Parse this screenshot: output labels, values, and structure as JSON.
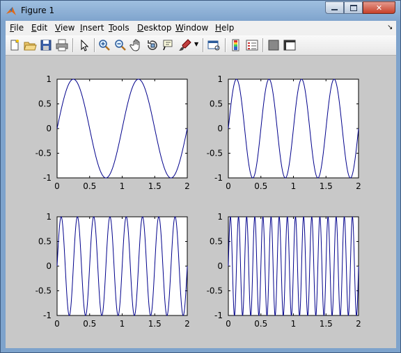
{
  "window": {
    "title": "Figure 1"
  },
  "menu": [
    {
      "key": "F",
      "rest": "ile"
    },
    {
      "key": "E",
      "rest": "dit"
    },
    {
      "key": "V",
      "rest": "iew"
    },
    {
      "key": "I",
      "rest": "nsert"
    },
    {
      "key": "T",
      "rest": "ools"
    },
    {
      "key": "D",
      "rest": "esktop"
    },
    {
      "key": "W",
      "rest": "indow"
    },
    {
      "key": "H",
      "rest": "elp"
    }
  ],
  "toolbar": [
    "new-figure-icon",
    "open-file-icon",
    "save-icon",
    "print-icon",
    "select-arrow-icon",
    "zoom-in-icon",
    "zoom-out-icon",
    "pan-hand-icon",
    "rotate-3d-icon",
    "data-cursor-icon",
    "brush-icon",
    "link-plot-icon",
    "colorbar-icon",
    "legend-icon",
    "hide-tools-icon",
    "show-tools-icon"
  ],
  "chart_data": [
    {
      "type": "line",
      "x_range": [
        0,
        2
      ],
      "ylim": [
        -1,
        1
      ],
      "frequency_hz": 1,
      "function": "sin(2*pi*f*x)",
      "xticks": [
        "0",
        "0.5",
        "1",
        "1.5",
        "2"
      ],
      "yticks": [
        "1",
        "0.5",
        "0",
        "-0.5",
        "-1"
      ],
      "color": "#00008b"
    },
    {
      "type": "line",
      "x_range": [
        0,
        2
      ],
      "ylim": [
        -1,
        1
      ],
      "frequency_hz": 2,
      "function": "sin(2*pi*f*x)",
      "xticks": [
        "0",
        "0.5",
        "1",
        "1.5",
        "2"
      ],
      "yticks": [
        "1",
        "0.5",
        "0",
        "-0.5",
        "-1"
      ],
      "color": "#00008b"
    },
    {
      "type": "line",
      "x_range": [
        0,
        2
      ],
      "ylim": [
        -1,
        1
      ],
      "frequency_hz": 4,
      "function": "sin(2*pi*f*x)",
      "xticks": [
        "0",
        "0.5",
        "1",
        "1.5",
        "2"
      ],
      "yticks": [
        "1",
        "0.5",
        "0",
        "-0.5",
        "-1"
      ],
      "color": "#00008b"
    },
    {
      "type": "line",
      "x_range": [
        0,
        2
      ],
      "ylim": [
        -1,
        1
      ],
      "frequency_hz": 8,
      "function": "sin(2*pi*f*x)",
      "xticks": [
        "0",
        "0.5",
        "1",
        "1.5",
        "2"
      ],
      "yticks": [
        "1",
        "0.5",
        "0",
        "-0.5",
        "-1"
      ],
      "color": "#00008b"
    }
  ]
}
